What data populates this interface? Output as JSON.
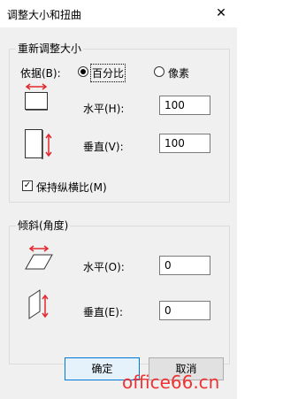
{
  "window": {
    "title": "调整大小和扭曲",
    "close_label": "✕"
  },
  "resize": {
    "legend": "重新调整大小",
    "by_label": "依据(B):",
    "options": {
      "percent": "百分比",
      "pixels": "像素"
    },
    "selected": "percent",
    "horizontal_label": "水平(H):",
    "horizontal_value": "100",
    "vertical_label": "垂直(V):",
    "vertical_value": "100",
    "keep_ratio_label": "保持纵横比(M)",
    "keep_ratio_checked": true
  },
  "skew": {
    "legend": "倾斜(角度)",
    "horizontal_label": "水平(O):",
    "horizontal_value": "0",
    "vertical_label": "垂直(E):",
    "vertical_value": "0"
  },
  "buttons": {
    "ok": "确定",
    "cancel": "取消"
  },
  "watermark": "office66.cn",
  "colors": {
    "arrow": "#e0282e",
    "accent": "#0078d7"
  }
}
